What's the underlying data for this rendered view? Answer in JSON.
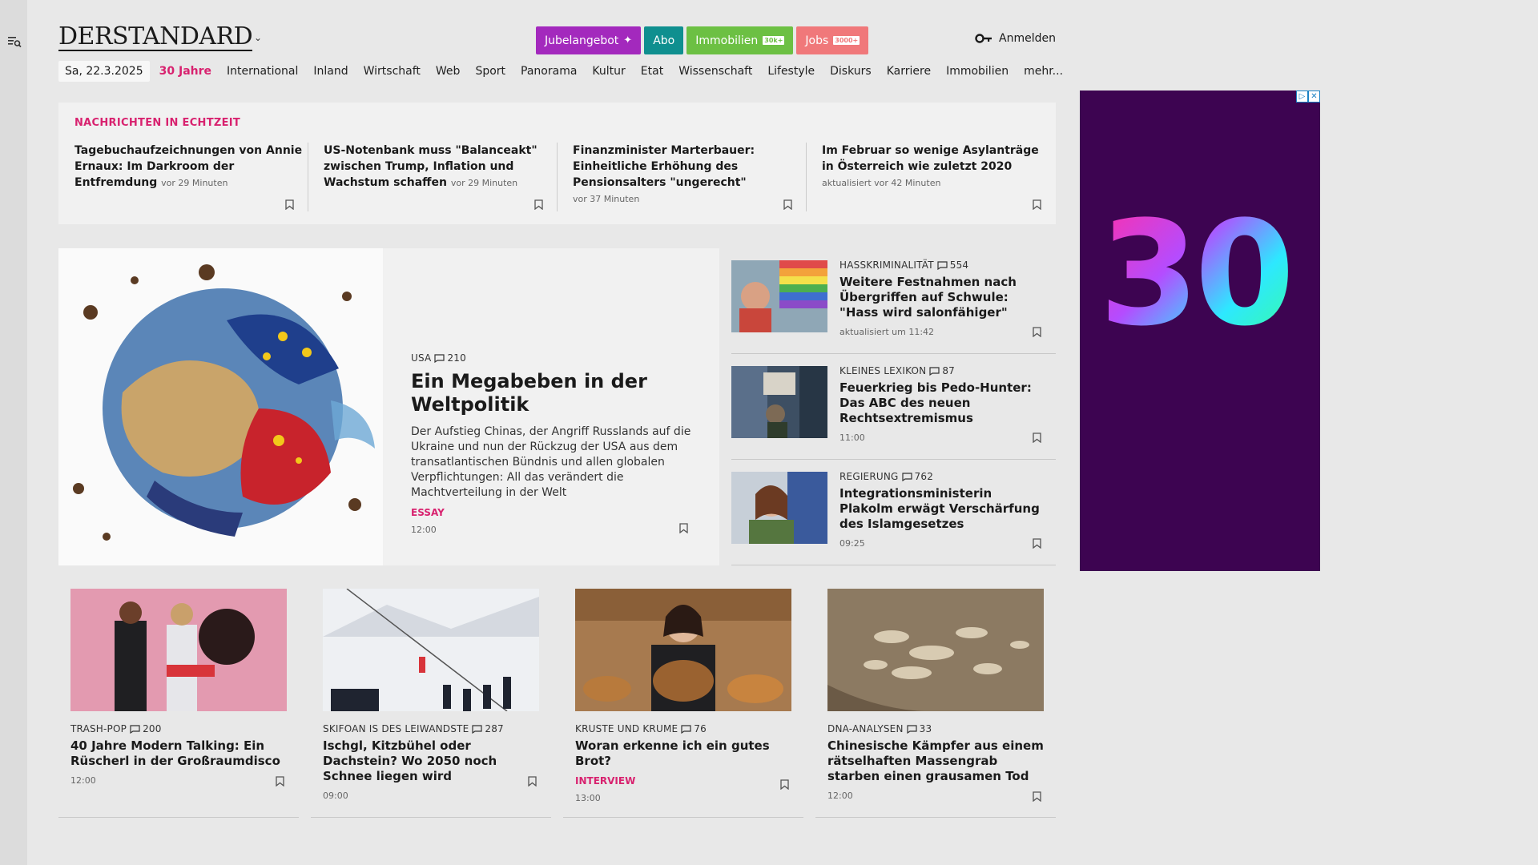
{
  "header": {
    "logo": "DERSTANDARD",
    "pills": [
      {
        "label": "Jubelangebot",
        "badge": "",
        "color": "#a329bd",
        "icon": "party-popper-icon"
      },
      {
        "label": "Abo",
        "badge": "",
        "color": "#0f8f8f"
      },
      {
        "label": "Immobilien",
        "badge": "30k+",
        "color": "#6cc043"
      },
      {
        "label": "Jobs",
        "badge": "3000+",
        "color": "#f0787a"
      }
    ],
    "login": "Anmelden"
  },
  "nav": {
    "date": "Sa, 22.3.2025",
    "items": [
      "30 Jahre",
      "International",
      "Inland",
      "Wirtschaft",
      "Web",
      "Sport",
      "Panorama",
      "Kultur",
      "Etat",
      "Wissenschaft",
      "Lifestyle",
      "Diskurs",
      "Karriere",
      "Immobilien",
      "mehr..."
    ],
    "highlight_color": "#d8226f"
  },
  "ticker": {
    "heading": "NACHRICHTEN IN ECHTZEIT",
    "items": [
      {
        "title": "Tagebuchaufzeichnungen von Annie Ernaux: Im Darkroom der Entfremdung",
        "meta": "vor 29 Minuten"
      },
      {
        "title": "US-Notenbank muss \"Balanceakt\" zwischen Trump, Inflation und Wachstum schaffen",
        "meta": "vor 29 Minuten"
      },
      {
        "title": "Finanzminister Marterbauer: Einheitliche Erhöhung des Pensionsalters \"ungerecht\"",
        "meta": "vor 37 Minuten"
      },
      {
        "title": "Im Februar so wenige Asylanträge in Österreich wie zuletzt 2020",
        "meta": "aktualisiert vor 42 Minuten"
      }
    ]
  },
  "hero": {
    "kicker": "USA",
    "comments": "210",
    "title": "Ein Megabeben in der Weltpolitik",
    "teaser": "Der Aufstieg Chinas, der Angriff Russlands auf die Ukraine und nun der Rückzug der USA aus dem transatlantischen Bündnis und allen globalen Verpflichtungen: All das verändert die Machtverteilung in der Welt",
    "tag": "ESSAY",
    "time": "12:00"
  },
  "side": [
    {
      "kicker": "HASSKRIMINALITÄT",
      "comments": "554",
      "title": "Weitere Festnahmen nach Übergriffen auf Schwule: \"Hass wird salonfähiger\"",
      "time": "aktualisiert um 11:42"
    },
    {
      "kicker": "KLEINES LEXIKON",
      "comments": "87",
      "title": "Feuerkrieg bis Pedo-Hunter: Das ABC des neuen Rechtsextremismus",
      "time": "11:00"
    },
    {
      "kicker": "REGIERUNG",
      "comments": "762",
      "title": "Integrationsministerin Plakolm erwägt Verschärfung des Islamgesetzes",
      "time": "09:25"
    }
  ],
  "cards": [
    {
      "kicker": "TRASH-POP",
      "comments": "200",
      "title": "40 Jahre Modern Talking: Ein Rüscherl in der Großraumdisco",
      "tag": "",
      "time": "12:00"
    },
    {
      "kicker": "SKIFOAN IS DES LEIWANDSTE",
      "comments": "287",
      "title": "Ischgl, Kitzbühel oder Dachstein? Wo 2050 noch Schnee liegen wird",
      "tag": "",
      "time": "09:00"
    },
    {
      "kicker": "KRUSTE UND KRUME",
      "comments": "76",
      "title": "Woran erkenne ich ein gutes Brot?",
      "tag": "INTERVIEW",
      "time": "13:00"
    },
    {
      "kicker": "DNA-ANALYSEN",
      "comments": "33",
      "title": "Chinesische Kämpfer aus einem rätselhaften Massengrab starben einen grausamen Tod",
      "tag": "",
      "time": "12:00"
    }
  ],
  "ad": {
    "number": "30",
    "adchoices": "▷",
    "close": "✕"
  }
}
